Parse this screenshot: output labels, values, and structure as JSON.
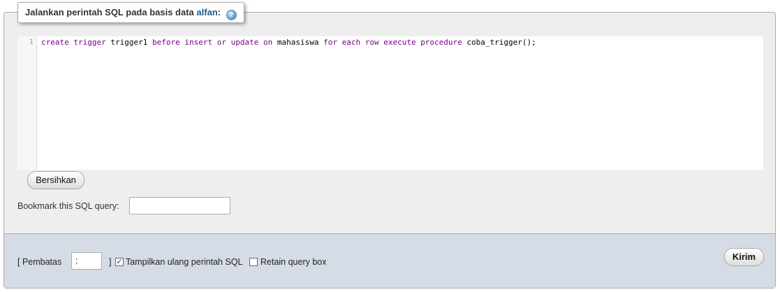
{
  "legend": {
    "prefix": "Jalankan perintah SQL pada basis data",
    "database": "alfan",
    "suffix": ":",
    "help_glyph": "?"
  },
  "editor": {
    "line_number": "1",
    "tokens": [
      {
        "text": "create",
        "kind": "kw"
      },
      {
        "text": " "
      },
      {
        "text": "trigger",
        "kind": "kw"
      },
      {
        "text": " trigger1 "
      },
      {
        "text": "before",
        "kind": "kw"
      },
      {
        "text": " "
      },
      {
        "text": "insert",
        "kind": "kw"
      },
      {
        "text": " "
      },
      {
        "text": "or",
        "kind": "kw"
      },
      {
        "text": " "
      },
      {
        "text": "update",
        "kind": "kw"
      },
      {
        "text": " "
      },
      {
        "text": "on",
        "kind": "kw"
      },
      {
        "text": " mahasiswa "
      },
      {
        "text": "for",
        "kind": "kw"
      },
      {
        "text": " "
      },
      {
        "text": "each",
        "kind": "kw"
      },
      {
        "text": " "
      },
      {
        "text": "row",
        "kind": "kw"
      },
      {
        "text": " "
      },
      {
        "text": "execute",
        "kind": "kw"
      },
      {
        "text": " "
      },
      {
        "text": "procedure",
        "kind": "kw"
      },
      {
        "text": " coba_trigger();"
      }
    ]
  },
  "clear_button": "Bersihkan",
  "bookmark": {
    "label": "Bookmark this SQL query:",
    "value": ""
  },
  "footer": {
    "delimiter_label": "[ Pembatas",
    "delimiter_value": ";",
    "delimiter_close": "]",
    "show_query_label": "Tampilkan ulang perintah SQL",
    "show_query_checked": "✓",
    "retain_label": "Retain query box",
    "retain_checked": "",
    "go_button": "Kirim"
  },
  "colors": {
    "keyword": "#770088",
    "footer_bg": "#d5dce6",
    "panel_bg": "#eeeeee"
  }
}
